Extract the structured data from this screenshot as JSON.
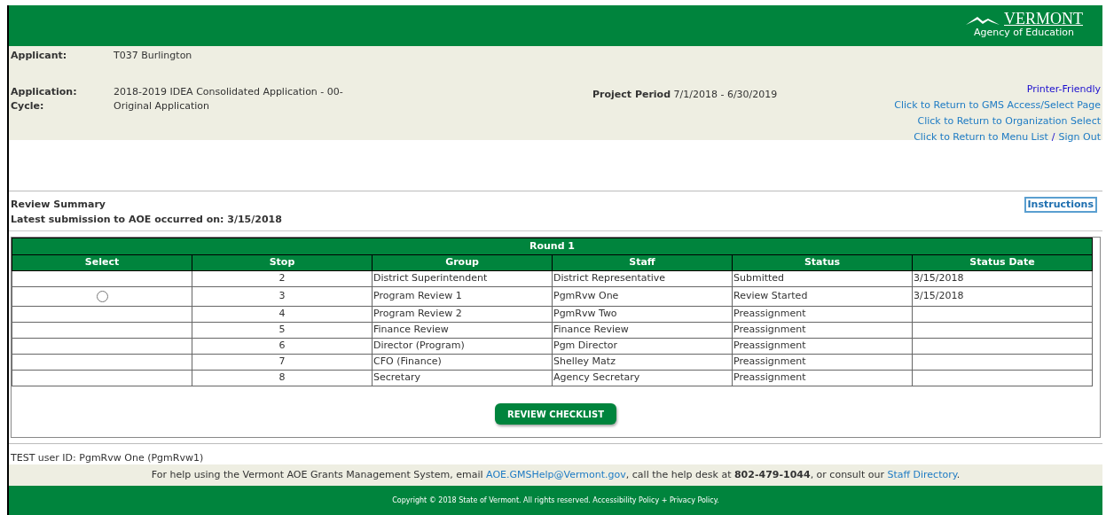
{
  "header": {
    "logo_title": "VERMONT",
    "logo_subtitle": "Agency of Education"
  },
  "info": {
    "applicant_label": "Applicant:",
    "applicant_value": "T037 Burlington",
    "cycle_label": "Application: Cycle:",
    "cycle_value": "2018-2019 IDEA Consolidated Application - 00-Original Application",
    "period_label": "Project Period",
    "period_value": "7/1/2018 - 6/30/2019"
  },
  "links": [
    {
      "text": "Printer-Friendly",
      "kind": "print"
    },
    {
      "text": "Click to Return to GMS Access/Select Page",
      "kind": "nav"
    },
    {
      "text": "Click to Return to Organization Select",
      "kind": "nav"
    }
  ],
  "last_links": [
    {
      "text": "Click to Return to Menu List"
    },
    {
      "text": "Sign Out"
    }
  ],
  "last_links_separator": "/",
  "summary": {
    "title": "Review Summary",
    "submission": "Latest submission to AOE occurred on: 3/15/2018",
    "instructions": "Instructions"
  },
  "table": {
    "caption": "Round 1",
    "columns": [
      "Select",
      "Stop",
      "Group",
      "Staff",
      "Status",
      "Status Date"
    ],
    "rows": [
      {
        "radio": null,
        "stop": "2",
        "group": "District Superintendent",
        "staff": "District Representative",
        "status": "Submitted",
        "date": "3/15/2018"
      },
      {
        "radio": {
          "selected": false
        },
        "stop": "3",
        "group": "Program Review 1",
        "staff": "PgmRvw One",
        "status": "Review Started",
        "date": "3/15/2018"
      },
      {
        "radio": null,
        "stop": "4",
        "group": "Program Review 2",
        "staff": "PgmRvw Two",
        "status": "Preassignment",
        "date": ""
      },
      {
        "radio": null,
        "stop": "5",
        "group": "Finance Review",
        "staff": "Finance Review",
        "status": "Preassignment",
        "date": ""
      },
      {
        "radio": null,
        "stop": "6",
        "group": "Director (Program)",
        "staff": "Pgm Director",
        "status": "Preassignment",
        "date": ""
      },
      {
        "radio": null,
        "stop": "7",
        "group": "CFO (Finance)",
        "staff": "Shelley Matz",
        "status": "Preassignment",
        "date": ""
      },
      {
        "radio": null,
        "stop": "8",
        "group": "Secretary",
        "staff": "Agency Secretary",
        "status": "Preassignment",
        "date": ""
      }
    ],
    "button": "REVIEW CHECKLIST"
  },
  "user_id": "TEST user ID: PgmRvw One (PgmRvw1)",
  "help": {
    "before": "For help using the Vermont AOE Grants Management System, email",
    "email": "AOE.GMSHelp@Vermont.gov",
    "middle": ", call the help desk at **802-479-1044**, or consult our",
    "link": "Staff Directory",
    "end": "."
  },
  "copyright": {
    "text": "Copyright © 2018 State of Vermont. All rights reserved.",
    "link1": "Accessibility Policy",
    "plus": "+",
    "link2": "Privacy Policy",
    "end": "."
  }
}
